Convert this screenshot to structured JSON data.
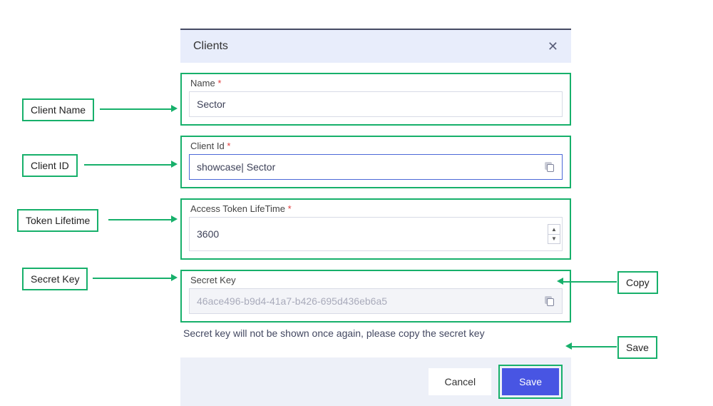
{
  "modal": {
    "title": "Clients",
    "name_label": "Name",
    "name_value": "Sector",
    "clientid_label": "Client Id",
    "clientid_value": "showcase| Sector",
    "lifetime_label": "Access Token LifeTime",
    "lifetime_value": "3600",
    "secret_label": "Secret Key",
    "secret_value": "46ace496-b9d4-41a7-b426-695d436eb6a5",
    "secret_hint": "Secret key will not be shown once again, please copy the secret key",
    "cancel": "Cancel",
    "save": "Save"
  },
  "callouts": {
    "name": "Client Name",
    "clientid": "Client ID",
    "lifetime": "Token Lifetime",
    "secret": "Secret Key",
    "copy": "Copy",
    "save": "Save"
  }
}
